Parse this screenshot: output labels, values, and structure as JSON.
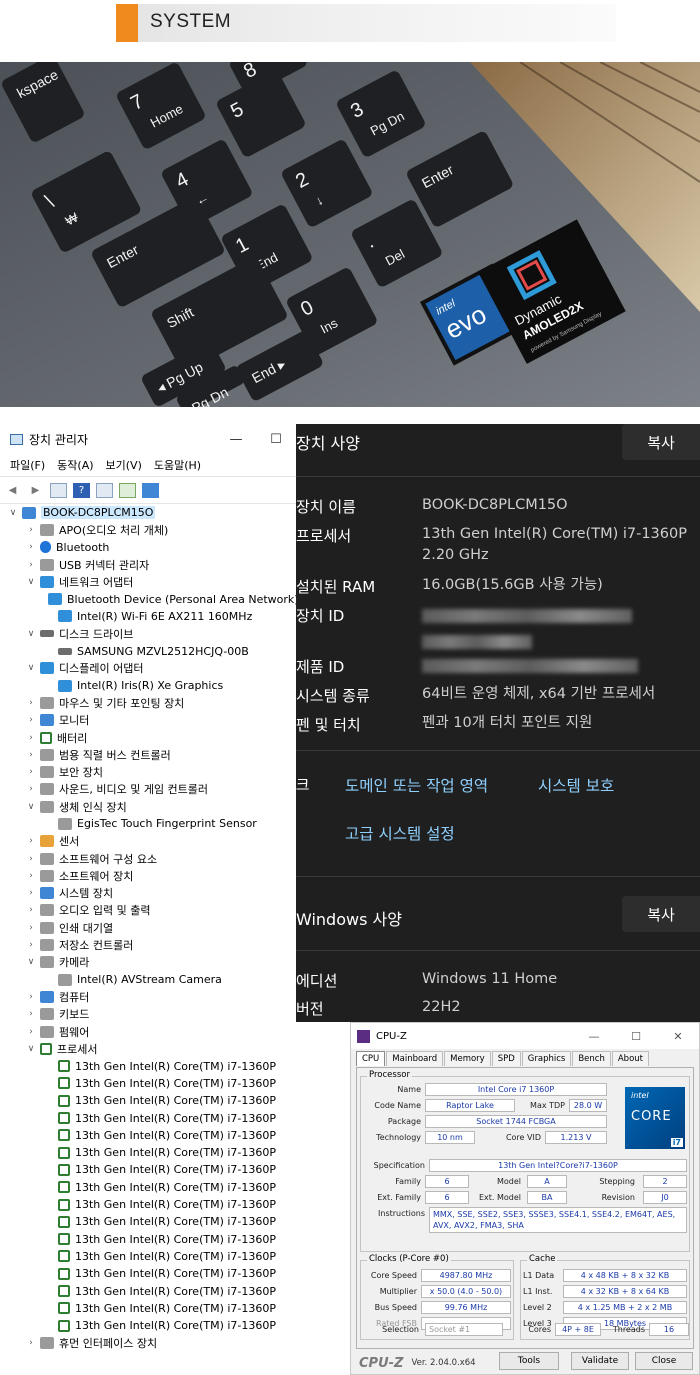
{
  "banner": {
    "title": "SYSTEM"
  },
  "photo": {
    "keys": [
      {
        "main": "7",
        "sub": "Home"
      },
      {
        "main": "8",
        "sub": "↑"
      },
      {
        "main": "5",
        "sub": ""
      },
      {
        "main": "3",
        "sub": "Pg Dn"
      },
      {
        "main": "4",
        "sub": "←"
      },
      {
        "main": "2",
        "sub": "↓"
      },
      {
        "main": "1",
        "sub": "End"
      },
      {
        "main": "0",
        "sub": "Ins"
      },
      {
        "main": ".",
        "sub": "Del"
      },
      {
        "main": "Enter",
        "sub": ""
      },
      {
        "main": "Enter",
        "sub": ""
      },
      {
        "main": "Shift",
        "sub": ""
      },
      {
        "main": "End ▸",
        "sub": ""
      },
      {
        "main": "◂ Pg Up",
        "sub": ""
      },
      {
        "main": "Pg Dn",
        "sub": ""
      },
      {
        "main": "\\",
        "sub": "₩"
      },
      {
        "main": "kspace",
        "sub": ""
      }
    ],
    "evo_sticker": {
      "brand": "intel",
      "name": "evo",
      "tier": "i7"
    },
    "amoled_sticker": {
      "line1": "Dynamic",
      "line2": "AMOLED2X",
      "line3": "powered by Samsung Display"
    }
  },
  "device_manager": {
    "title": "장치 관리자",
    "minimize": "—",
    "maximize": "☐",
    "menu": [
      "파일(F)",
      "동작(A)",
      "보기(V)",
      "도움말(H)"
    ],
    "tree": [
      {
        "level": 0,
        "exp": "∨",
        "icon": "computer",
        "label": "BOOK-DC8PLCM15O",
        "selected": true
      },
      {
        "level": 1,
        "exp": "›",
        "icon": "audio",
        "label": "APO(오디오 처리 개체)"
      },
      {
        "level": 1,
        "exp": "›",
        "icon": "bluetooth",
        "label": "Bluetooth"
      },
      {
        "level": 1,
        "exp": "›",
        "icon": "usb",
        "label": "USB 커넥터 관리자"
      },
      {
        "level": 1,
        "exp": "∨",
        "icon": "network",
        "label": "네트워크 어댑터"
      },
      {
        "level": 2,
        "exp": "",
        "icon": "network",
        "label": "Bluetooth Device (Personal Area Network)"
      },
      {
        "level": 2,
        "exp": "",
        "icon": "network",
        "label": "Intel(R) Wi-Fi 6E AX211 160MHz"
      },
      {
        "level": 1,
        "exp": "∨",
        "icon": "disk",
        "label": "디스크 드라이브"
      },
      {
        "level": 2,
        "exp": "",
        "icon": "disk",
        "label": "SAMSUNG MZVL2512HCJQ-00B"
      },
      {
        "level": 1,
        "exp": "∨",
        "icon": "display",
        "label": "디스플레이 어댑터"
      },
      {
        "level": 2,
        "exp": "",
        "icon": "display",
        "label": "Intel(R) Iris(R) Xe Graphics"
      },
      {
        "level": 1,
        "exp": "›",
        "icon": "mouse",
        "label": "마우스 및 기타 포인팅 장치"
      },
      {
        "level": 1,
        "exp": "›",
        "icon": "monitor",
        "label": "모니터"
      },
      {
        "level": 1,
        "exp": "›",
        "icon": "battery",
        "label": "배터리"
      },
      {
        "level": 1,
        "exp": "›",
        "icon": "bus",
        "label": "범용 직렬 버스 컨트롤러"
      },
      {
        "level": 1,
        "exp": "›",
        "icon": "security",
        "label": "보안 장치"
      },
      {
        "level": 1,
        "exp": "›",
        "icon": "sound",
        "label": "사운드, 비디오 및 게임 컨트롤러"
      },
      {
        "level": 1,
        "exp": "∨",
        "icon": "biometric",
        "label": "생체 인식 장치"
      },
      {
        "level": 2,
        "exp": "",
        "icon": "biometric",
        "label": "EgisTec Touch Fingerprint Sensor"
      },
      {
        "level": 1,
        "exp": "›",
        "icon": "sensor",
        "label": "센서"
      },
      {
        "level": 1,
        "exp": "›",
        "icon": "software",
        "label": "소프트웨어 구성 요소"
      },
      {
        "level": 1,
        "exp": "›",
        "icon": "software",
        "label": "소프트웨어 장치"
      },
      {
        "level": 1,
        "exp": "›",
        "icon": "system",
        "label": "시스템 장치"
      },
      {
        "level": 1,
        "exp": "›",
        "icon": "audio",
        "label": "오디오 입력 및 출력"
      },
      {
        "level": 1,
        "exp": "›",
        "icon": "printer",
        "label": "인쇄 대기열"
      },
      {
        "level": 1,
        "exp": "›",
        "icon": "storage",
        "label": "저장소 컨트롤러"
      },
      {
        "level": 1,
        "exp": "∨",
        "icon": "camera",
        "label": "카메라"
      },
      {
        "level": 2,
        "exp": "",
        "icon": "camera",
        "label": "Intel(R) AVStream Camera"
      },
      {
        "level": 1,
        "exp": "›",
        "icon": "computer",
        "label": "컴퓨터"
      },
      {
        "level": 1,
        "exp": "›",
        "icon": "keyboard",
        "label": "키보드"
      },
      {
        "level": 1,
        "exp": "›",
        "icon": "firmware",
        "label": "펌웨어"
      },
      {
        "level": 1,
        "exp": "∨",
        "icon": "processor",
        "label": "프로세서"
      },
      {
        "level": 2,
        "exp": "",
        "icon": "processor",
        "label": "13th Gen Intel(R) Core(TM) i7-1360P"
      },
      {
        "level": 2,
        "exp": "",
        "icon": "processor",
        "label": "13th Gen Intel(R) Core(TM) i7-1360P"
      },
      {
        "level": 2,
        "exp": "",
        "icon": "processor",
        "label": "13th Gen Intel(R) Core(TM) i7-1360P"
      },
      {
        "level": 2,
        "exp": "",
        "icon": "processor",
        "label": "13th Gen Intel(R) Core(TM) i7-1360P"
      },
      {
        "level": 2,
        "exp": "",
        "icon": "processor",
        "label": "13th Gen Intel(R) Core(TM) i7-1360P"
      },
      {
        "level": 2,
        "exp": "",
        "icon": "processor",
        "label": "13th Gen Intel(R) Core(TM) i7-1360P"
      },
      {
        "level": 2,
        "exp": "",
        "icon": "processor",
        "label": "13th Gen Intel(R) Core(TM) i7-1360P"
      },
      {
        "level": 2,
        "exp": "",
        "icon": "processor",
        "label": "13th Gen Intel(R) Core(TM) i7-1360P"
      },
      {
        "level": 2,
        "exp": "",
        "icon": "processor",
        "label": "13th Gen Intel(R) Core(TM) i7-1360P"
      },
      {
        "level": 2,
        "exp": "",
        "icon": "processor",
        "label": "13th Gen Intel(R) Core(TM) i7-1360P"
      },
      {
        "level": 2,
        "exp": "",
        "icon": "processor",
        "label": "13th Gen Intel(R) Core(TM) i7-1360P"
      },
      {
        "level": 2,
        "exp": "",
        "icon": "processor",
        "label": "13th Gen Intel(R) Core(TM) i7-1360P"
      },
      {
        "level": 2,
        "exp": "",
        "icon": "processor",
        "label": "13th Gen Intel(R) Core(TM) i7-1360P"
      },
      {
        "level": 2,
        "exp": "",
        "icon": "processor",
        "label": "13th Gen Intel(R) Core(TM) i7-1360P"
      },
      {
        "level": 2,
        "exp": "",
        "icon": "processor",
        "label": "13th Gen Intel(R) Core(TM) i7-1360P"
      },
      {
        "level": 2,
        "exp": "",
        "icon": "processor",
        "label": "13th Gen Intel(R) Core(TM) i7-1360P"
      },
      {
        "level": 1,
        "exp": "›",
        "icon": "hid",
        "label": "휴먼 인터페이스 장치"
      }
    ]
  },
  "settings": {
    "device_spec_title": "장치 사양",
    "copy_label": "복사",
    "device_name_key": "장치 이름",
    "device_name": "BOOK-DC8PLCM15O",
    "processor_key": "프로세서",
    "processor_line1": "13th Gen Intel(R) Core(TM) i7-1360P",
    "processor_line2": "2.20 GHz",
    "ram_key": "설치된 RAM",
    "ram": "16.0GB(15.6GB 사용 가능)",
    "device_id_key": "장치 ID",
    "product_id_key": "제품 ID",
    "system_type_key": "시스템 종류",
    "system_type": "64비트 운영 체제, x64 기반 프로세서",
    "pen_key": "펜 및 터치",
    "pen": "펜과 10개 터치 포인트 지원",
    "links_key": "링크",
    "link_domain": "도메인 또는 작업 영역",
    "link_protection": "시스템 보호",
    "link_advanced": "고급 시스템 설정",
    "windows_spec_title": "Windows 사양",
    "edition_key": "에디션",
    "edition": "Windows 11 Home",
    "version_key": "버전",
    "version": "22H2"
  },
  "cpuz": {
    "title": "CPU-Z",
    "tabs": [
      "CPU",
      "Mainboard",
      "Memory",
      "SPD",
      "Graphics",
      "Bench",
      "About"
    ],
    "processor_group": "Processor",
    "name_label": "Name",
    "name": "Intel Core i7 1360P",
    "codename_label": "Code Name",
    "codename": "Raptor Lake",
    "maxtdp_label": "Max TDP",
    "maxtdp": "28.0 W",
    "package_label": "Package",
    "package": "Socket 1744 FCBGA",
    "technology_label": "Technology",
    "technology": "10 nm",
    "corevid_label": "Core VID",
    "corevid": "1.213 V",
    "spec_label": "Specification",
    "spec": "13th Gen Intel?Core?i7-1360P",
    "family_label": "Family",
    "family": "6",
    "model_label": "Model",
    "model": "A",
    "stepping_label": "Stepping",
    "stepping": "2",
    "extfamily_label": "Ext. Family",
    "extfamily": "6",
    "extmodel_label": "Ext. Model",
    "extmodel": "BA",
    "revision_label": "Revision",
    "revision": "J0",
    "instructions_label": "Instructions",
    "instructions": "MMX, SSE, SSE2, SSE3, SSSE3, SSE4.1, SSE4.2, EM64T, AES, AVX, AVX2, FMA3, SHA",
    "logo": {
      "brand": "intel",
      "family": "CORE",
      "tier": "i7"
    },
    "clocks_group": "Clocks (P-Core #0)",
    "corespeed_label": "Core Speed",
    "corespeed": "4987.80 MHz",
    "multiplier_label": "Multiplier",
    "multiplier": "x 50.0 (4.0 - 50.0)",
    "busspeed_label": "Bus Speed",
    "busspeed": "99.76 MHz",
    "ratedfsb_label": "Rated FSB",
    "ratedfsb": "",
    "cache_group": "Cache",
    "l1data_label": "L1 Data",
    "l1data": "4 x 48 KB + 8 x 32 KB",
    "l1inst_label": "L1 Inst.",
    "l1inst": "4 x 32 KB + 8 x 64 KB",
    "level2_label": "Level 2",
    "level2": "4 x 1.25 MB + 2 x 2 MB",
    "level3_label": "Level 3",
    "level3": "18 MBytes",
    "selection_label": "Selection",
    "selection": "Socket #1",
    "cores_label": "Cores",
    "cores": "4P + 8E",
    "threads_label": "Threads",
    "threads": "16",
    "brand": "CPU-Z",
    "version": "Ver. 2.04.0.x64",
    "tools_label": "Tools",
    "validate_label": "Validate",
    "close_label": "Close"
  }
}
